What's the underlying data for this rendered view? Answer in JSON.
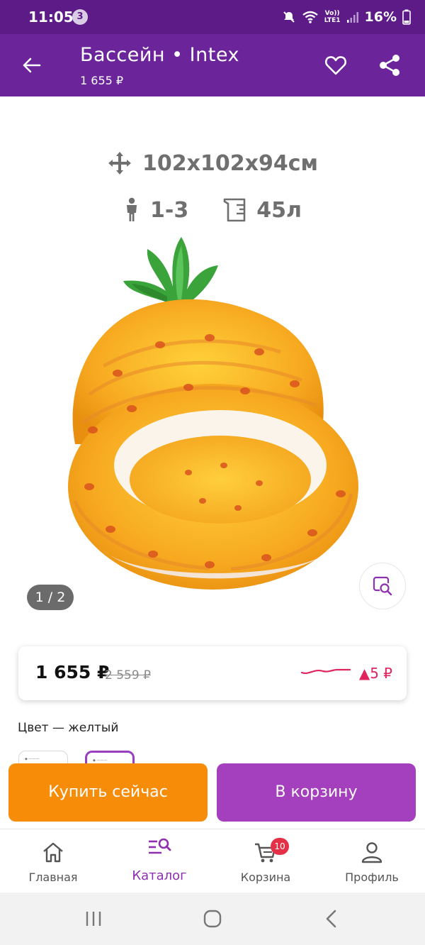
{
  "status_bar": {
    "time": "11:05",
    "notification_count": "3",
    "network_label_top": "Vo))",
    "network_label_bottom": "LTE1",
    "battery": "16%"
  },
  "app_bar": {
    "title": "Бассейн • Intex",
    "subtitle": "1 655 ₽"
  },
  "product": {
    "dimensions": "102x102x94см",
    "age": "1-3",
    "volume": "45л",
    "image_counter": "1 / 2"
  },
  "price": {
    "current": "1 655 ₽",
    "old": "2 559 ₽",
    "change": "▲5 ₽"
  },
  "color": {
    "label": "Цвет — желтый"
  },
  "actions": {
    "buy_now": "Купить сейчас",
    "add_to_cart": "В корзину"
  },
  "bottom_nav": {
    "home": "Главная",
    "catalog": "Каталог",
    "cart": "Корзина",
    "cart_badge": "10",
    "profile": "Профиль"
  },
  "colors": {
    "status_bar": "#5d1b87",
    "app_bar": "#6b2499",
    "buy_button": "#f78c08",
    "cart_button": "#a43fbe",
    "active_nav": "#8e2fb0",
    "price_up": "#e0245e"
  }
}
